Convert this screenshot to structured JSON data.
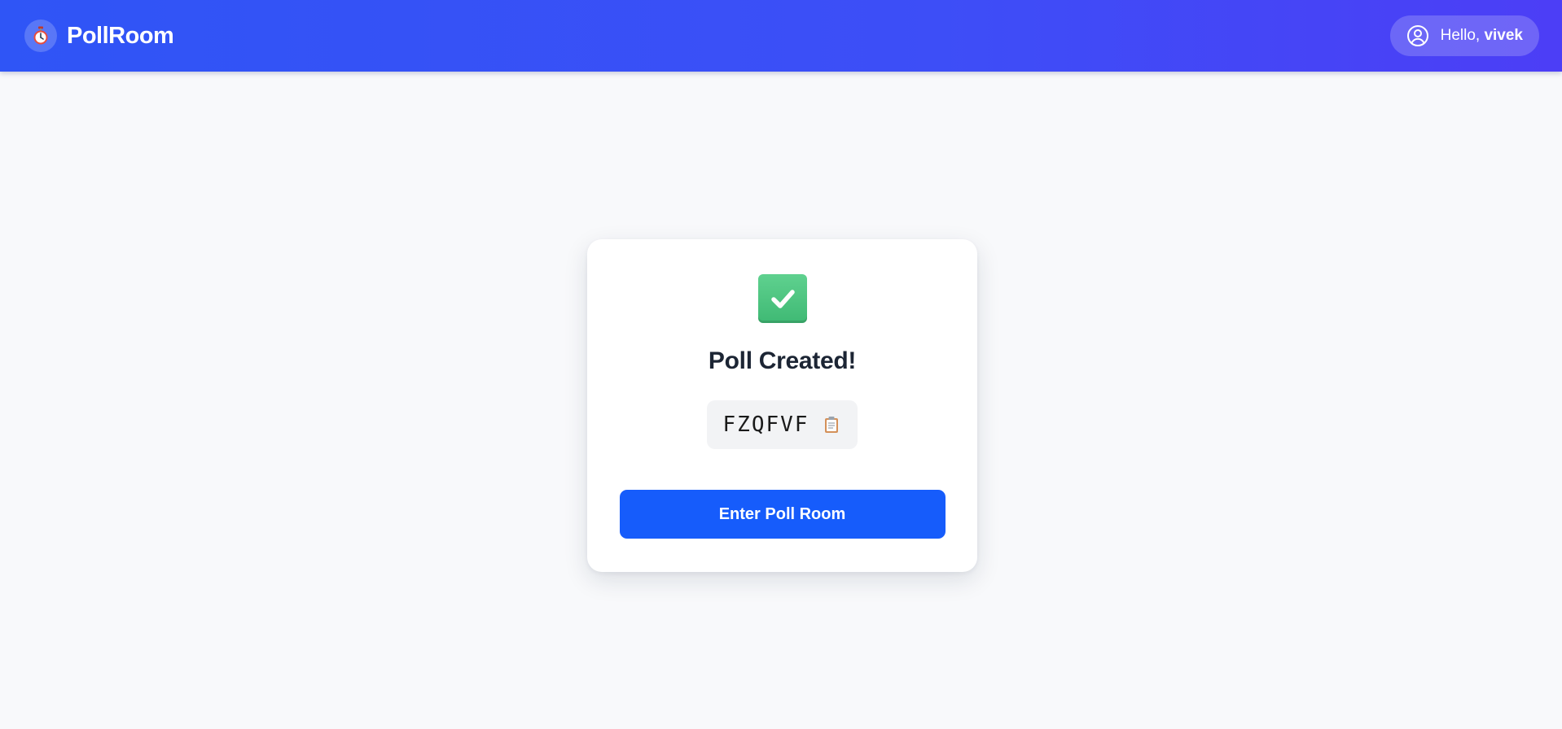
{
  "navbar": {
    "brand_name": "PollRoom",
    "logo_icon": "stopwatch-icon",
    "greeting_prefix": "Hello,",
    "username": "vivek",
    "user_icon": "user-circle-icon"
  },
  "card": {
    "status_icon": "check-mark-button-icon",
    "title": "Poll Created!",
    "poll_code": "FZQFVF",
    "copy_icon": "clipboard-icon",
    "enter_button_label": "Enter Poll Room"
  },
  "colors": {
    "navbar_gradient_start": "#2f55f6",
    "navbar_gradient_end": "#4c3ef6",
    "primary_button": "#165cfb",
    "page_background": "#f8f9fb",
    "title_text": "#1c2534",
    "success_green": "#4cc482"
  }
}
